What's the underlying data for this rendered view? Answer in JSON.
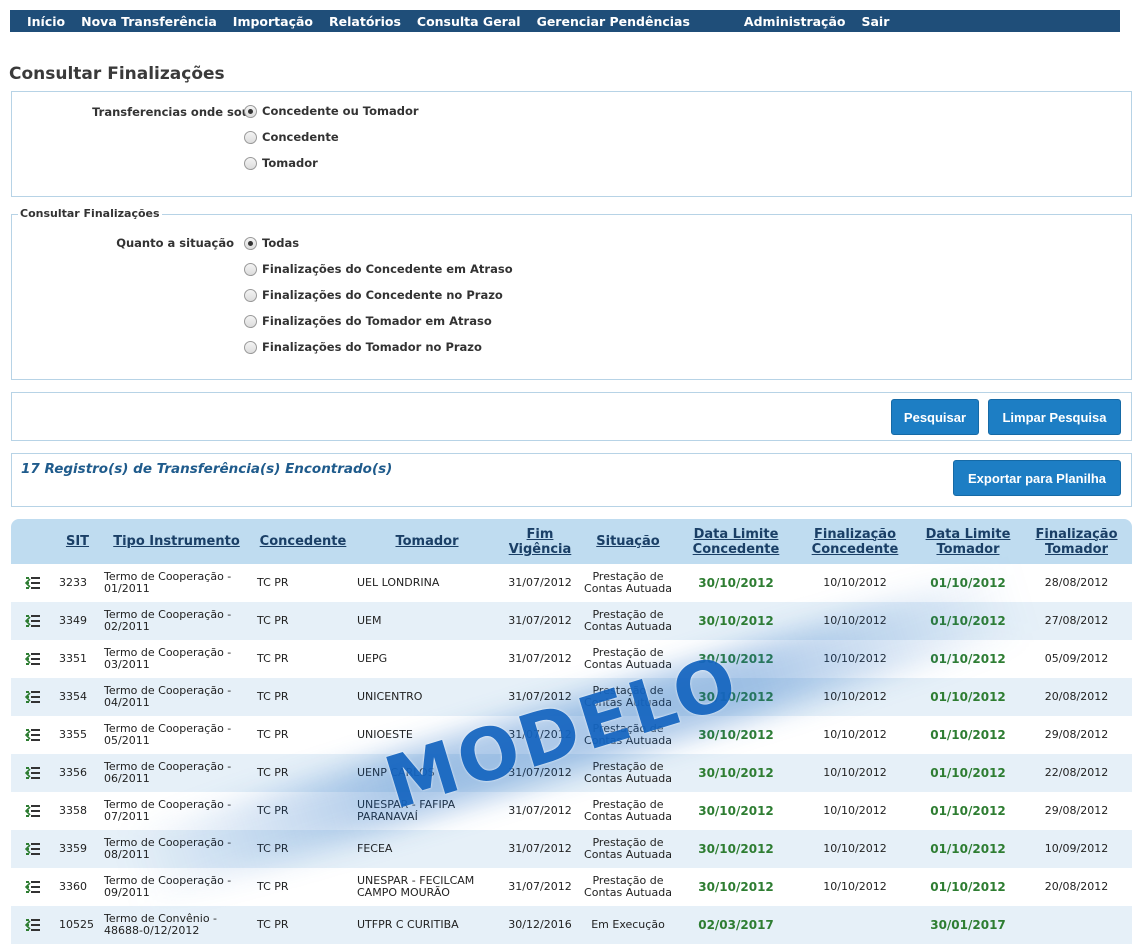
{
  "nav": {
    "items": [
      "Início",
      "Nova Transferência",
      "Importação",
      "Relatórios",
      "Consulta Geral",
      "Gerenciar Pendências"
    ],
    "items_right": [
      "Administração",
      "Sair"
    ]
  },
  "page_title": "Consultar Finalizações",
  "filter_role": {
    "label": "Transferencias onde sou",
    "options": [
      "Concedente ou Tomador",
      "Concedente",
      "Tomador"
    ],
    "selected": "Concedente ou Tomador"
  },
  "filter_status": {
    "legend": "Consultar Finalizações",
    "label": "Quanto a situação",
    "options": [
      "Todas",
      "Finalizações do Concedente em Atraso",
      "Finalizações do Concedente no Prazo",
      "Finalizações do Tomador em Atraso",
      "Finalizações do Tomador no Prazo"
    ],
    "selected": "Todas"
  },
  "actions": {
    "search": "Pesquisar",
    "clear": "Limpar Pesquisa"
  },
  "results": {
    "count_text": "17 Registro(s) de Transferência(s) Encontrado(s)",
    "export": "Exportar para Planilha"
  },
  "table": {
    "headers": {
      "sit": "SIT",
      "tipo": "Tipo Instrumento",
      "concedente": "Concedente",
      "tomador": "Tomador",
      "fim_vigencia": "Fim Vigência",
      "situacao": "Situação",
      "dl_concedente": "Data Limite Concedente",
      "fin_concedente": "Finalização Concedente",
      "dl_tomador": "Data Limite Tomador",
      "fin_tomador": "Finalização Tomador"
    },
    "rows": [
      {
        "sit": "3233",
        "tipo": "Termo de Cooperação - 01/2011",
        "concedente": "TC PR",
        "tomador": "UEL LONDRINA",
        "fim": "31/07/2012",
        "situacao": "Prestação de Contas Autuada",
        "dlc": "30/10/2012",
        "fc": "10/10/2012",
        "dlt": "01/10/2012",
        "ft": "28/08/2012"
      },
      {
        "sit": "3349",
        "tipo": "Termo de Cooperação - 02/2011",
        "concedente": "TC PR",
        "tomador": "UEM",
        "fim": "31/07/2012",
        "situacao": "Prestação de Contas Autuada",
        "dlc": "30/10/2012",
        "fc": "10/10/2012",
        "dlt": "01/10/2012",
        "ft": "27/08/2012"
      },
      {
        "sit": "3351",
        "tipo": "Termo de Cooperação - 03/2011",
        "concedente": "TC PR",
        "tomador": "UEPG",
        "fim": "31/07/2012",
        "situacao": "Prestação de Contas Autuada",
        "dlc": "30/10/2012",
        "fc": "10/10/2012",
        "dlt": "01/10/2012",
        "ft": "05/09/2012"
      },
      {
        "sit": "3354",
        "tipo": "Termo de Cooperação - 04/2011",
        "concedente": "TC PR",
        "tomador": "UNICENTRO",
        "fim": "31/07/2012",
        "situacao": "Prestação de Contas Autuada",
        "dlc": "30/10/2012",
        "fc": "10/10/2012",
        "dlt": "01/10/2012",
        "ft": "20/08/2012"
      },
      {
        "sit": "3355",
        "tipo": "Termo de Cooperação - 05/2011",
        "concedente": "TC PR",
        "tomador": "UNIOESTE",
        "fim": "31/07/2012",
        "situacao": "Prestação de Contas Autuada",
        "dlc": "30/10/2012",
        "fc": "10/10/2012",
        "dlt": "01/10/2012",
        "ft": "29/08/2012"
      },
      {
        "sit": "3356",
        "tipo": "Termo de Cooperação - 06/2011",
        "concedente": "TC PR",
        "tomador": "UENP CARLOS",
        "fim": "31/07/2012",
        "situacao": "Prestação de Contas Autuada",
        "dlc": "30/10/2012",
        "fc": "10/10/2012",
        "dlt": "01/10/2012",
        "ft": "22/08/2012"
      },
      {
        "sit": "3358",
        "tipo": "Termo de Cooperação - 07/2011",
        "concedente": "TC PR",
        "tomador": "UNESPAR - FAFIPA PARANAVAÍ",
        "fim": "31/07/2012",
        "situacao": "Prestação de Contas Autuada",
        "dlc": "30/10/2012",
        "fc": "10/10/2012",
        "dlt": "01/10/2012",
        "ft": "29/08/2012"
      },
      {
        "sit": "3359",
        "tipo": "Termo de Cooperação - 08/2011",
        "concedente": "TC PR",
        "tomador": "FECEA",
        "fim": "31/07/2012",
        "situacao": "Prestação de Contas Autuada",
        "dlc": "30/10/2012",
        "fc": "10/10/2012",
        "dlt": "01/10/2012",
        "ft": "10/09/2012"
      },
      {
        "sit": "3360",
        "tipo": "Termo de Cooperação - 09/2011",
        "concedente": "TC PR",
        "tomador": "UNESPAR - FECILCAM CAMPO MOURÃO",
        "fim": "31/07/2012",
        "situacao": "Prestação de Contas Autuada",
        "dlc": "30/10/2012",
        "fc": "10/10/2012",
        "dlt": "01/10/2012",
        "ft": "20/08/2012"
      },
      {
        "sit": "10525",
        "tipo": "Termo de Convênio - 48688-0/12/2012",
        "concedente": "TC PR",
        "tomador": "UTFPR C CURITIBA",
        "fim": "30/12/2016",
        "situacao": "Em Execução",
        "dlc": "02/03/2017",
        "fc": "",
        "dlt": "30/01/2017",
        "ft": ""
      }
    ]
  },
  "watermark": "MODELO",
  "colors": {
    "nav_bg": "#1f4e79",
    "button": "#1d7ec4",
    "header_bg": "#bfdcf0",
    "deadline_green": "#2e7d32",
    "watermark": "#1565c0"
  },
  "icons": {
    "row_action": "finalize-list-icon"
  }
}
